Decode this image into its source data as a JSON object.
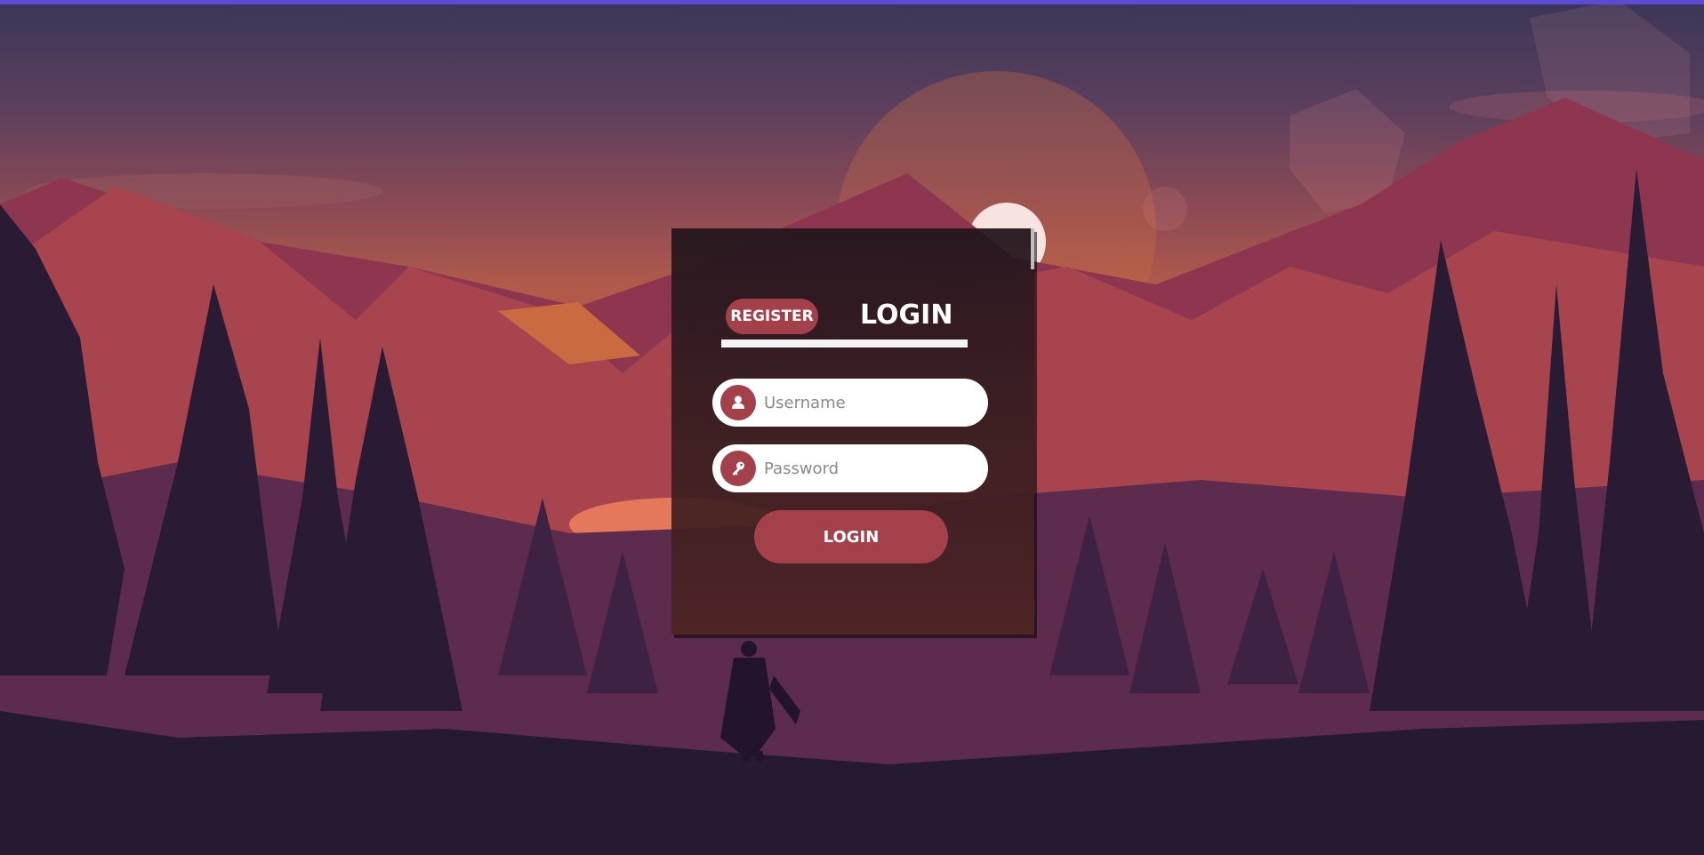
{
  "login_card": {
    "tabs": {
      "register_label": "REGISTER",
      "login_label": "LOGIN"
    },
    "username": {
      "placeholder": "Username",
      "value": ""
    },
    "password": {
      "placeholder": "Password",
      "value": ""
    },
    "submit_label": "LOGIN"
  },
  "icons": {
    "username": "user-icon",
    "password": "key-icon"
  },
  "colors": {
    "accent": "#a3404a",
    "top_bar": "#5b4bd6",
    "card_background": "#2a1a22"
  }
}
